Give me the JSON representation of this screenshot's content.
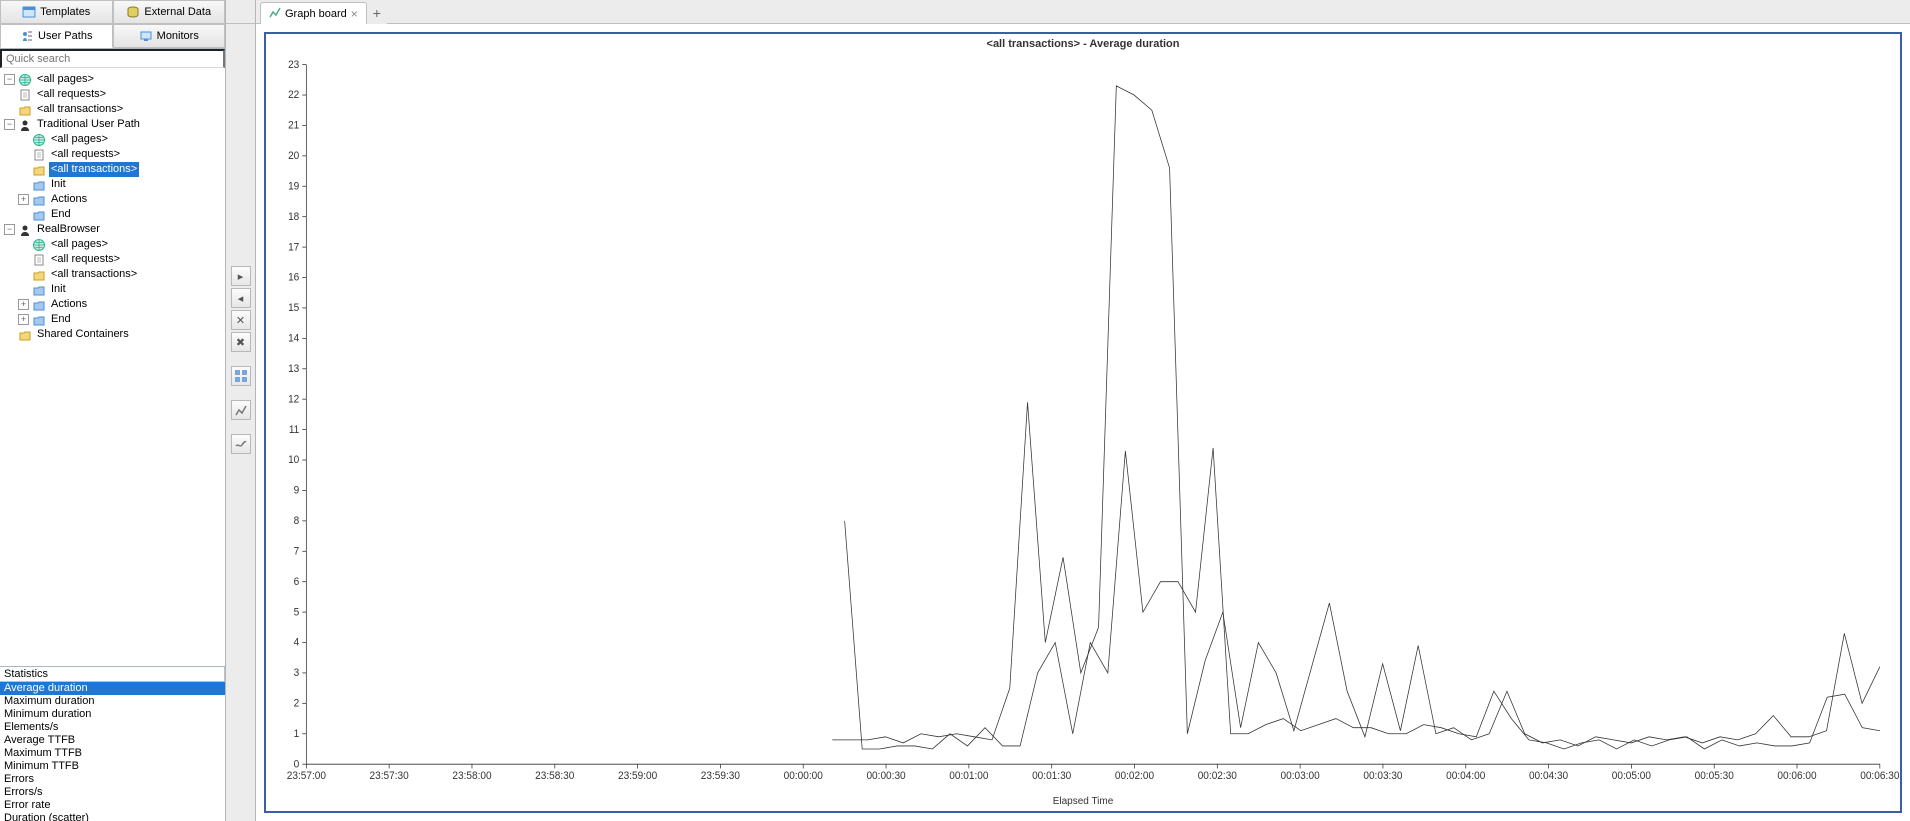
{
  "left_tabs": {
    "templates": "Templates",
    "external_data": "External Data",
    "user_paths": "User Paths",
    "monitors": "Monitors"
  },
  "quicksearch_placeholder": "Quick search",
  "tree": [
    {
      "indent": 0,
      "twisty": "minus",
      "icon": "globe",
      "label": "<all pages>"
    },
    {
      "indent": 0,
      "twisty": "none",
      "icon": "page",
      "label": "<all requests>"
    },
    {
      "indent": 0,
      "twisty": "none",
      "icon": "folder",
      "label": "<all transactions>"
    },
    {
      "indent": 0,
      "twisty": "minus",
      "icon": "user",
      "label": "Traditional User Path"
    },
    {
      "indent": 1,
      "twisty": "none",
      "icon": "globe",
      "label": "<all pages>"
    },
    {
      "indent": 1,
      "twisty": "none",
      "icon": "page",
      "label": "<all requests>"
    },
    {
      "indent": 1,
      "twisty": "none",
      "icon": "folder",
      "label": "<all transactions>",
      "selected": true
    },
    {
      "indent": 1,
      "twisty": "none",
      "icon": "folder-blue",
      "label": "Init"
    },
    {
      "indent": 1,
      "twisty": "plus",
      "icon": "folder-blue",
      "label": "Actions"
    },
    {
      "indent": 1,
      "twisty": "none",
      "icon": "folder-blue",
      "label": "End"
    },
    {
      "indent": 0,
      "twisty": "minus",
      "icon": "user",
      "label": "RealBrowser"
    },
    {
      "indent": 1,
      "twisty": "none",
      "icon": "globe",
      "label": "<all pages>"
    },
    {
      "indent": 1,
      "twisty": "none",
      "icon": "page",
      "label": "<all requests>"
    },
    {
      "indent": 1,
      "twisty": "none",
      "icon": "folder",
      "label": "<all transactions>"
    },
    {
      "indent": 1,
      "twisty": "none",
      "icon": "folder-blue",
      "label": "Init"
    },
    {
      "indent": 1,
      "twisty": "plus",
      "icon": "folder-blue",
      "label": "Actions"
    },
    {
      "indent": 1,
      "twisty": "plus",
      "icon": "folder-blue",
      "label": "End"
    },
    {
      "indent": 0,
      "twisty": "none",
      "icon": "folder",
      "label": "Shared Containers"
    }
  ],
  "stats": {
    "header": "Statistics",
    "items": [
      {
        "label": "Average duration",
        "selected": true
      },
      {
        "label": "Maximum duration"
      },
      {
        "label": "Minimum duration"
      },
      {
        "label": "Elements/s"
      },
      {
        "label": "Average TTFB"
      },
      {
        "label": "Maximum TTFB"
      },
      {
        "label": "Minimum TTFB"
      },
      {
        "label": "Errors"
      },
      {
        "label": "Errors/s"
      },
      {
        "label": "Error rate"
      },
      {
        "label": "Duration (scatter)"
      }
    ]
  },
  "main_tab": {
    "label": "Graph board"
  },
  "chart_data": {
    "type": "line",
    "title": "<all transactions> - Average duration",
    "xlabel": "Elapsed Time",
    "ylabel": "",
    "ylim": [
      0,
      23
    ],
    "x_ticks": [
      "23:57:00",
      "23:57:30",
      "23:58:00",
      "23:58:30",
      "23:59:00",
      "23:59:30",
      "00:00:00",
      "00:00:30",
      "00:01:00",
      "00:01:30",
      "00:02:00",
      "00:02:30",
      "00:03:00",
      "00:03:30",
      "00:04:00",
      "00:04:30",
      "00:05:00",
      "00:05:30",
      "00:06:00",
      "00:06:30"
    ],
    "series": [
      {
        "name": "blue",
        "color": "#4a90d9",
        "start_index": 6.35,
        "values": [
          0.8,
          0.8,
          0.8,
          0.9,
          0.7,
          1.0,
          0.9,
          1.0,
          0.9,
          0.8,
          2.5,
          11.9,
          4.0,
          6.8,
          3.0,
          4.5,
          22.3,
          22.0,
          21.5,
          19.6,
          1.0,
          3.4,
          5.0,
          1.2,
          4.0,
          3.0,
          1.1,
          3.2,
          5.3,
          2.4,
          0.9,
          3.3,
          1.1,
          3.9,
          1.0,
          1.2,
          0.8,
          1.0,
          2.4,
          1.0,
          0.7,
          0.8,
          0.6,
          0.9,
          0.8,
          0.7,
          0.9,
          0.8,
          0.9,
          0.7,
          0.9,
          0.8,
          1.0,
          1.6,
          0.9,
          0.9,
          1.1,
          4.3,
          2.0,
          3.2
        ]
      },
      {
        "name": "olive",
        "color": "#a6a523",
        "start_index": 6.5,
        "values": [
          8.0,
          0.5,
          0.5,
          0.6,
          0.6,
          0.5,
          1.0,
          0.6,
          1.2,
          0.6,
          0.6,
          3.0,
          4.0,
          1.0,
          4.0,
          3.0,
          10.3,
          5.0,
          6.0,
          6.0,
          5.0,
          10.4,
          1.0,
          1.0,
          1.3,
          1.5,
          1.1,
          1.3,
          1.5,
          1.2,
          1.2,
          1.0,
          1.0,
          1.3,
          1.2,
          1.0,
          0.9,
          2.4,
          1.5,
          0.8,
          0.7,
          0.5,
          0.7,
          0.8,
          0.5,
          0.8,
          0.6,
          0.8,
          0.9,
          0.5,
          0.8,
          0.6,
          0.7,
          0.6,
          0.6,
          0.7,
          2.2,
          2.3,
          1.2,
          1.1
        ]
      }
    ]
  }
}
